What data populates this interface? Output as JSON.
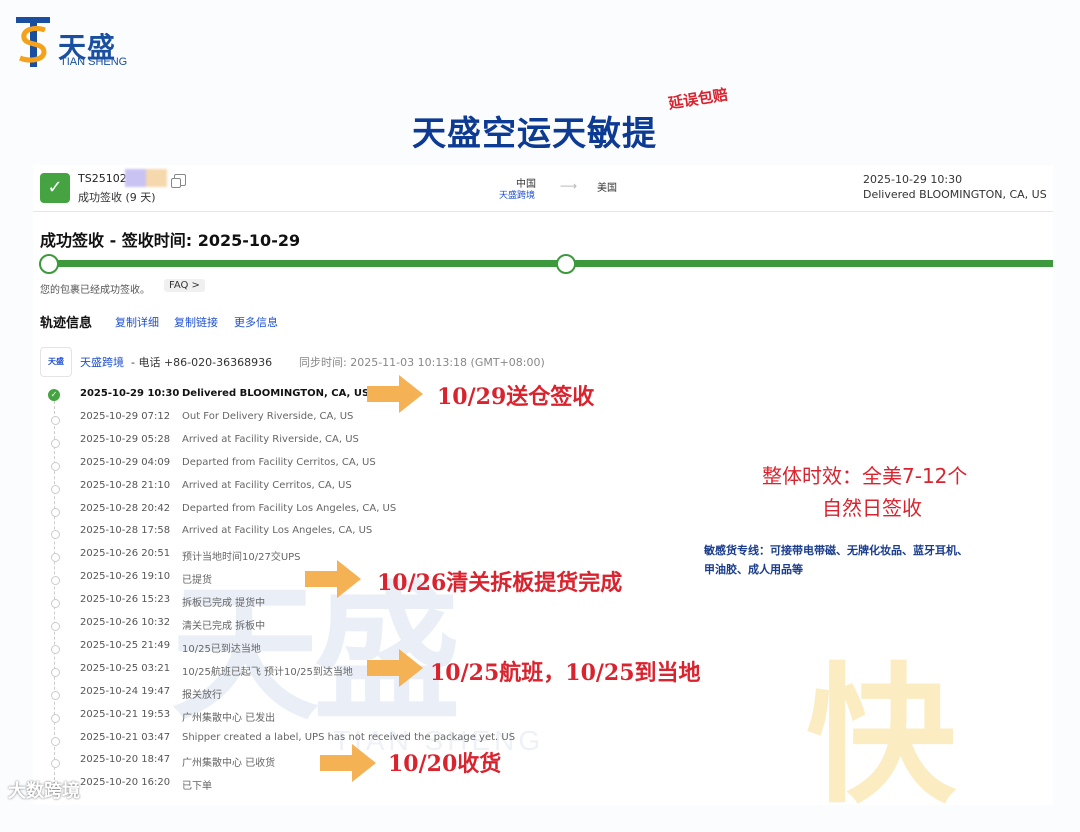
{
  "brand": {
    "name_cn": "天盛",
    "name_en": "TIAN SHENG",
    "mark_letters": "TS"
  },
  "headline": "天盛空运天敏提",
  "stamp": "延误包赔",
  "shipment": {
    "tracking_no": "TS251026",
    "status": "成功签收 (9 天)",
    "origin": "中国",
    "origin_sub": "天盛跨境",
    "destination": "美国",
    "latest_time": "2025-10-29 10:30",
    "latest_status": "Delivered BLOOMINGTON, CA, US"
  },
  "progress": {
    "title": "成功签收 - 签收时间: 2025-10-29",
    "subtitle": "您的包裹已经成功签收。",
    "faq": "FAQ >",
    "percent": 100
  },
  "tracking": {
    "heading": "轨迹信息",
    "links": [
      "复制详细",
      "复制链接",
      "更多信息"
    ],
    "carrier_logo": "天盛",
    "carrier": "天盛跨境",
    "phone": "- 电话 +86-020-36368936",
    "sync": "同步时间: 2025-11-03 10:13:18 (GMT+08:00)",
    "events": [
      {
        "time": "2025-10-29 10:30",
        "desc": "Delivered BLOOMINGTON, CA, US"
      },
      {
        "time": "2025-10-29 07:12",
        "desc": "Out For Delivery Riverside, CA, US"
      },
      {
        "time": "2025-10-29 05:28",
        "desc": "Arrived at Facility Riverside, CA, US"
      },
      {
        "time": "2025-10-29 04:09",
        "desc": "Departed from Facility Cerritos, CA, US"
      },
      {
        "time": "2025-10-28 21:10",
        "desc": "Arrived at Facility Cerritos, CA, US"
      },
      {
        "time": "2025-10-28 20:42",
        "desc": "Departed from Facility Los Angeles, CA, US"
      },
      {
        "time": "2025-10-28 17:58",
        "desc": "Arrived at Facility Los Angeles, CA, US"
      },
      {
        "time": "2025-10-26 20:51",
        "desc": "预计当地时间10/27交UPS"
      },
      {
        "time": "2025-10-26 19:10",
        "desc": "已提货"
      },
      {
        "time": "2025-10-26 15:23",
        "desc": "拆板已完成 提货中"
      },
      {
        "time": "2025-10-26 10:32",
        "desc": "清关已完成 拆板中"
      },
      {
        "time": "2025-10-25 21:49",
        "desc": "10/25已到达当地"
      },
      {
        "time": "2025-10-25 03:21",
        "desc": "10/25航班已起飞 预计10/25到达当地"
      },
      {
        "time": "2025-10-24 19:47",
        "desc": "报关放行"
      },
      {
        "time": "2025-10-21 19:53",
        "desc": "广州集散中心 已发出"
      },
      {
        "time": "2025-10-21 03:47",
        "desc": "Shipper created a label, UPS has not received the package yet. US"
      },
      {
        "time": "2025-10-20 18:47",
        "desc": "广州集散中心 已收货"
      },
      {
        "time": "2025-10-20 16:20",
        "desc": "已下单"
      }
    ]
  },
  "annotations": [
    "10/29送仓签收",
    "10/26清关拆板提货完成",
    "10/25航班，10/25到当地",
    "10/20收货"
  ],
  "summary": [
    "整体时效：全美7-12个",
    "自然日签收"
  ],
  "sensitive": [
    "敏感货专线：可接带电带磁、无牌化妆品、蓝牙耳机、",
    "甲油胶、成人用品等"
  ],
  "watermark": {
    "cn": "天盛",
    "en": "TIAN SHENG",
    "kuai": "快"
  },
  "footer": "大数跨境",
  "colors": {
    "brand_blue": "#0d3a92",
    "success_green": "#45a341",
    "accent_red": "#d9232e",
    "arrow_orange": "#f4b254"
  }
}
